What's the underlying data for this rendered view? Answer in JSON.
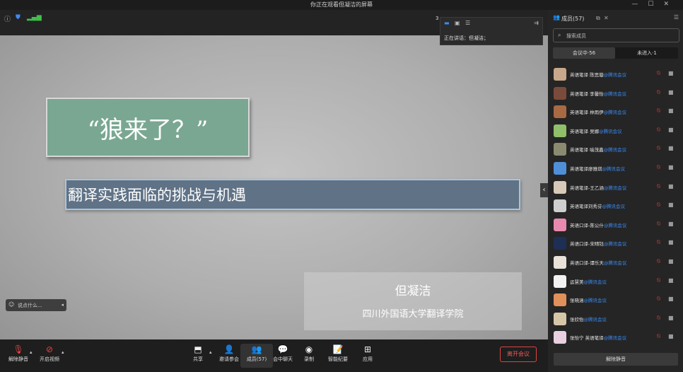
{
  "window": {
    "title": "你正在观看但凝洁的屏幕"
  },
  "top_bar": {
    "page_indicator": "3"
  },
  "slide": {
    "title": "“狼来了？”",
    "subtitle": "翻译实践面临的挑战与机遇",
    "presenter_name": "但凝洁",
    "presenter_org": "四川外国语大学翻译学院"
  },
  "comment": {
    "placeholder": "说点什么..."
  },
  "speaker": {
    "label": "正在讲话：但凝洁；"
  },
  "toolbar": {
    "unmute": "解除静音",
    "video": "开启视频",
    "share": "共享",
    "invite": "邀请参会",
    "members": "成员(57)",
    "chat": "会中聊天",
    "record": "录制",
    "minutes": "智能纪要",
    "apps": "应用",
    "leave": "离开会议"
  },
  "panel": {
    "title": "成员(57)",
    "search_placeholder": "搜索成员",
    "tab_in": "会议中·56",
    "tab_out": "未进入·1",
    "unmute_all": "解除静音",
    "members": [
      {
        "name": "英语笔译 陈思璇",
        "tag": "@腾讯会议",
        "color": "#c7a88a"
      },
      {
        "name": "英语笔译 李馨怡",
        "tag": "@腾讯会议",
        "color": "#7a4b3a"
      },
      {
        "name": "英语笔译 林雨伊",
        "tag": "@腾讯会议",
        "color": "#a86a42"
      },
      {
        "name": "英语笔译 吴娜",
        "tag": "@腾讯会议",
        "color": "#8fbf6a"
      },
      {
        "name": "英语笔译 喻茂鑫",
        "tag": "@腾讯会议",
        "color": "#8a8a70"
      },
      {
        "name": "英语笔译廖雅琪",
        "tag": "@腾讯会议",
        "color": "#4f8fd8"
      },
      {
        "name": "英语笔译-王乙涵",
        "tag": "@腾讯会议",
        "color": "#d9c9b8"
      },
      {
        "name": "英语笔译刘秀芬",
        "tag": "@腾讯会议",
        "color": "#cfcfcf"
      },
      {
        "name": "英语口译-陈公什",
        "tag": "@腾讯会议",
        "color": "#e88ab0"
      },
      {
        "name": "英语口译-宋晴钰",
        "tag": "@腾讯会议",
        "color": "#1e2f55"
      },
      {
        "name": "英语口译-谭乐天",
        "tag": "@腾讯会议",
        "color": "#e8e2d8"
      },
      {
        "name": "运慧美",
        "tag": "@腾讯会议",
        "color": "#f2f2f2"
      },
      {
        "name": "张晓涵",
        "tag": "@腾讯会议",
        "color": "#e0905a"
      },
      {
        "name": "张欣怡",
        "tag": "@腾讯会议",
        "color": "#d6c6a8"
      },
      {
        "name": "张怡宁 英语笔译",
        "tag": "@腾讯会议",
        "color": "#e8d0e0"
      }
    ]
  }
}
